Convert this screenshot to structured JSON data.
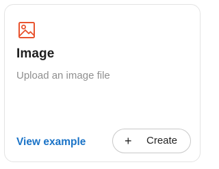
{
  "card": {
    "icon": "image-icon",
    "title": "Image",
    "description": "Upload an image file",
    "view_example_label": "View example",
    "create_label": "Create",
    "create_icon": "plus-icon"
  },
  "colors": {
    "icon_accent": "#e8532e",
    "link": "#1a73c7",
    "title": "#1f1f1f",
    "description": "#8f8f8f"
  }
}
